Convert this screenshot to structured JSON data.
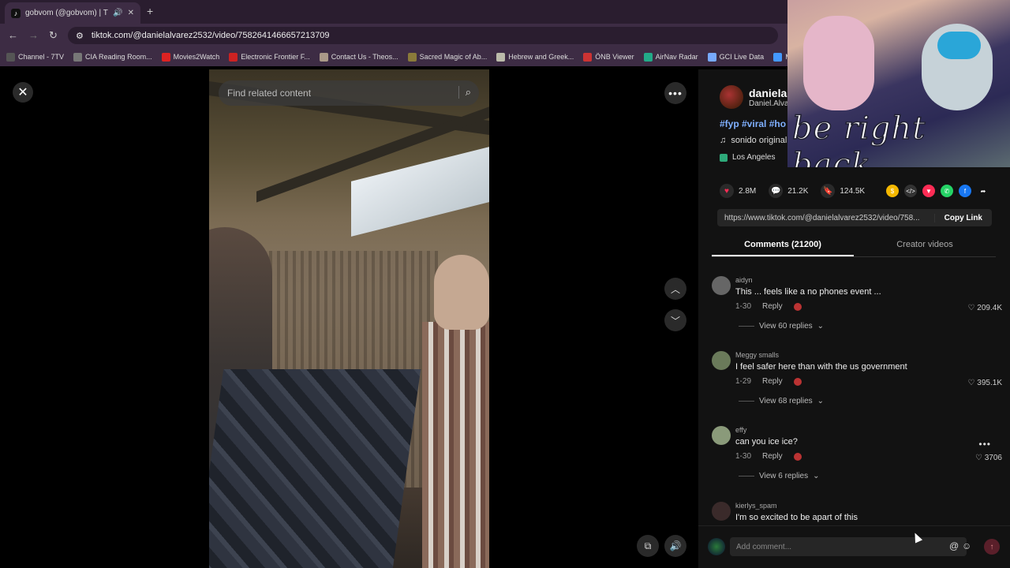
{
  "browser": {
    "tab_title": "gobvom (@gobvom) | TikTo",
    "url": "tiktok.com/@danielalvarez2532/video/7582641466657213709",
    "bookmarks": [
      {
        "label": "Channel - 7TV",
        "color": "#555"
      },
      {
        "label": "CIA Reading Room...",
        "color": "#777"
      },
      {
        "label": "Movies2Watch",
        "color": "#d22"
      },
      {
        "label": "Electronic Frontier F...",
        "color": "#c22"
      },
      {
        "label": "Contact Us - Theos...",
        "color": "#a98"
      },
      {
        "label": "Sacred Magic of Ab...",
        "color": "#8a7a3a"
      },
      {
        "label": "Hebrew and Greek...",
        "color": "#bba"
      },
      {
        "label": "ÖNB Viewer",
        "color": "#c33"
      },
      {
        "label": "AirNav Radar",
        "color": "#2a8"
      },
      {
        "label": "GCI Live Data",
        "color": "#7af"
      },
      {
        "label": "Mi",
        "color": "#49f"
      }
    ]
  },
  "video": {
    "search_placeholder": "Find related content"
  },
  "creator": {
    "username": "danielal",
    "nickname": "Daniel.Alva",
    "hashtags": "#fyp #viral #ho",
    "sound": "sonido original",
    "location": "Los Angeles"
  },
  "stats": {
    "likes": "2.8M",
    "comments": "21.2K",
    "saves": "124.5K"
  },
  "share": {
    "link": "https://www.tiktok.com/@danielalvarez2532/video/758...",
    "copy_label": "Copy Link"
  },
  "tabs": {
    "comments": "Comments (21200)",
    "creator_videos": "Creator videos"
  },
  "comments": [
    {
      "user": "aidyn",
      "text": "This ... feels like a no phones event ...",
      "date": "1-30",
      "reply": "Reply",
      "likes": "209.4K",
      "view_replies": "View 60 replies",
      "avatar_color": "#666"
    },
    {
      "user": "Meggy smalls",
      "text": "I feel safer here than with the us government",
      "date": "1-29",
      "reply": "Reply",
      "likes": "395.1K",
      "view_replies": "View 68 replies",
      "avatar_color": "#6a7a5a"
    },
    {
      "user": "effy",
      "text": "can you ice ice?",
      "date": "1-30",
      "reply": "Reply",
      "likes": "3706",
      "view_replies": "View 6 replies",
      "avatar_color": "#8a9a7a"
    },
    {
      "user": "kierlys_spam",
      "text": "I'm so excited to be apart of this",
      "avatar_color": "#3a2a2a"
    }
  ],
  "composer": {
    "placeholder": "Add comment..."
  },
  "overlay": {
    "caption": "be right back"
  }
}
